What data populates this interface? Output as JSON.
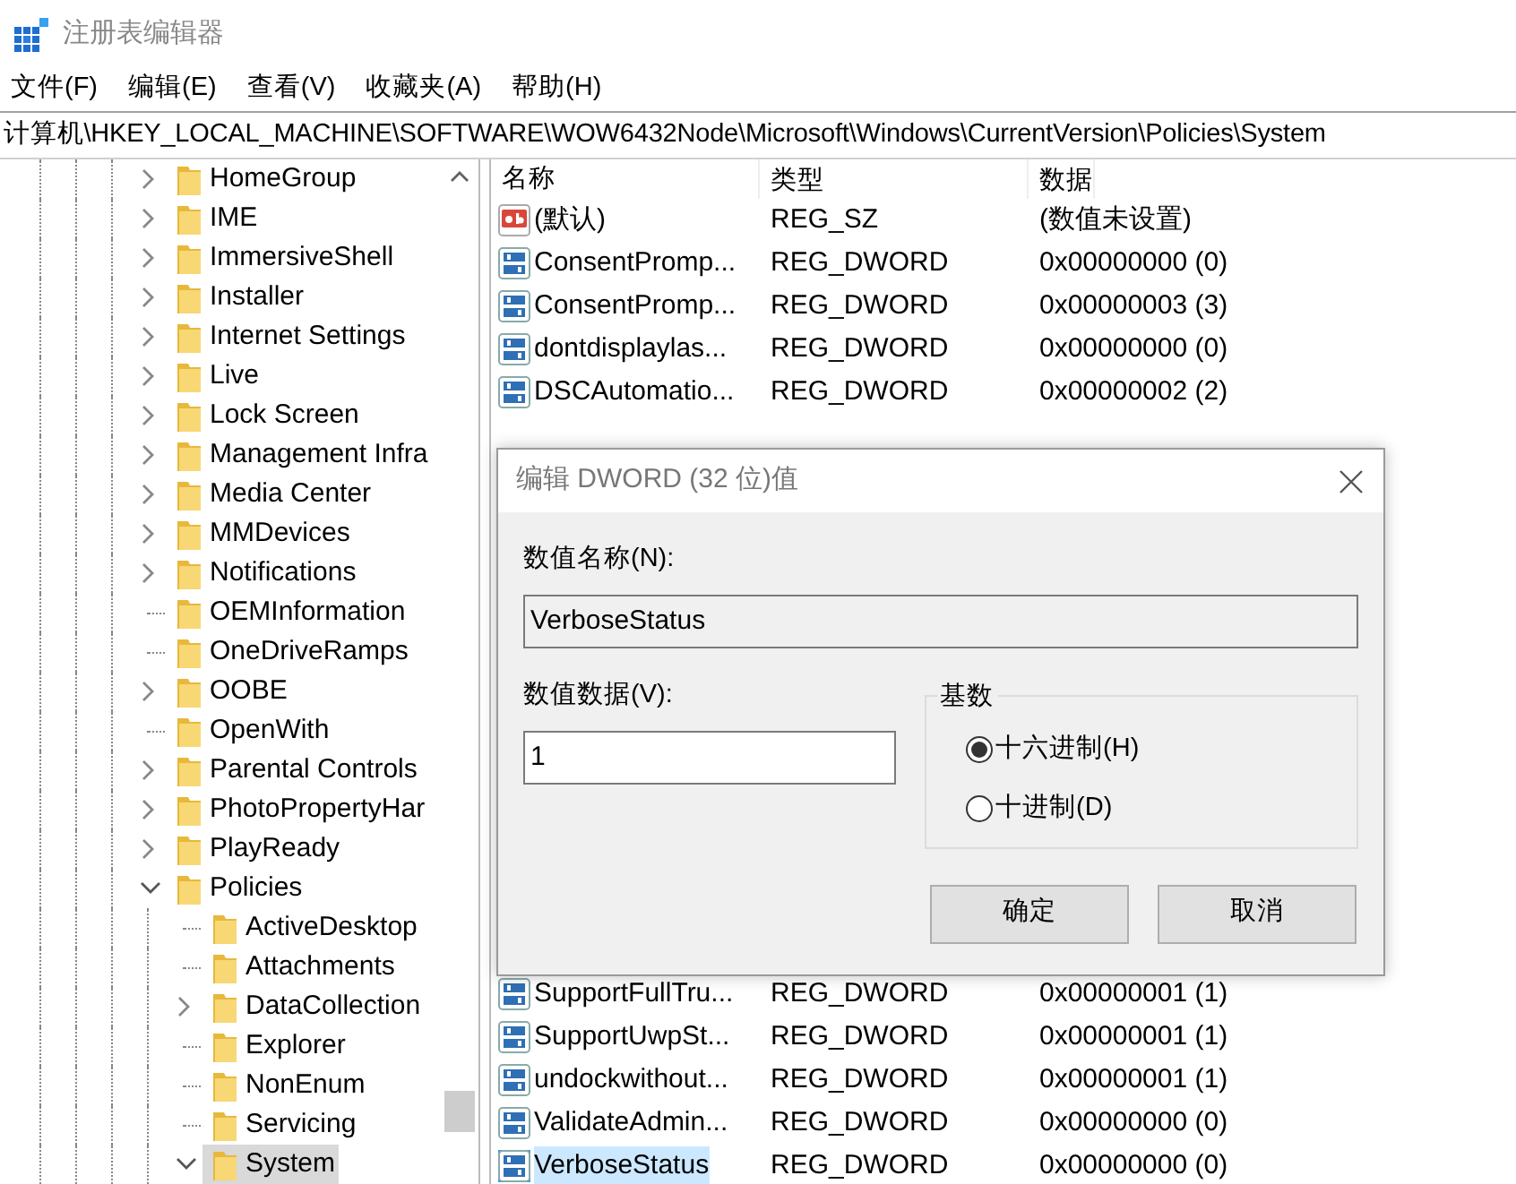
{
  "window": {
    "title": "注册表编辑器"
  },
  "menu": [
    {
      "label": "文件(F)"
    },
    {
      "label": "编辑(E)"
    },
    {
      "label": "查看(V)"
    },
    {
      "label": "收藏夹(A)"
    },
    {
      "label": "帮助(H)"
    }
  ],
  "address": "计算机\\HKEY_LOCAL_MACHINE\\SOFTWARE\\WOW6432Node\\Microsoft\\Windows\\CurrentVersion\\Policies\\System",
  "tree": {
    "items": [
      {
        "label": "HomeGroup",
        "expandable": true,
        "expanded": false,
        "selected": false
      },
      {
        "label": "IME",
        "expandable": true,
        "expanded": false,
        "selected": false
      },
      {
        "label": "ImmersiveShell",
        "expandable": true,
        "expanded": false,
        "selected": false
      },
      {
        "label": "Installer",
        "expandable": true,
        "expanded": false,
        "selected": false
      },
      {
        "label": "Internet Settings",
        "expandable": true,
        "expanded": false,
        "selected": false
      },
      {
        "label": "Live",
        "expandable": true,
        "expanded": false,
        "selected": false
      },
      {
        "label": "Lock Screen",
        "expandable": true,
        "expanded": false,
        "selected": false
      },
      {
        "label": "Management Infra",
        "expandable": true,
        "expanded": false,
        "selected": false
      },
      {
        "label": "Media Center",
        "expandable": true,
        "expanded": false,
        "selected": false
      },
      {
        "label": "MMDevices",
        "expandable": true,
        "expanded": false,
        "selected": false
      },
      {
        "label": "Notifications",
        "expandable": true,
        "expanded": false,
        "selected": false
      },
      {
        "label": "OEMInformation",
        "expandable": false,
        "selected": false
      },
      {
        "label": "OneDriveRamps",
        "expandable": false,
        "selected": false
      },
      {
        "label": "OOBE",
        "expandable": true,
        "expanded": false,
        "selected": false
      },
      {
        "label": "OpenWith",
        "expandable": false,
        "selected": false
      },
      {
        "label": "Parental Controls",
        "expandable": true,
        "expanded": false,
        "selected": false
      },
      {
        "label": "PhotoPropertyHar",
        "expandable": true,
        "expanded": false,
        "selected": false
      },
      {
        "label": "PlayReady",
        "expandable": true,
        "expanded": false,
        "selected": false
      },
      {
        "label": "Policies",
        "expandable": true,
        "expanded": true,
        "selected": false,
        "children": [
          {
            "label": "ActiveDesktop",
            "expandable": false,
            "selected": false
          },
          {
            "label": "Attachments",
            "expandable": false,
            "selected": false
          },
          {
            "label": "DataCollection",
            "expandable": true,
            "expanded": false,
            "selected": false
          },
          {
            "label": "Explorer",
            "expandable": false,
            "selected": false
          },
          {
            "label": "NonEnum",
            "expandable": false,
            "selected": false
          },
          {
            "label": "Servicing",
            "expandable": false,
            "selected": false
          },
          {
            "label": "System",
            "expandable": true,
            "expanded": true,
            "selected": true
          }
        ]
      }
    ]
  },
  "list": {
    "columns": [
      "名称",
      "类型",
      "数据"
    ],
    "rows": [
      {
        "kind": "string",
        "name": "(默认)",
        "type": "REG_SZ",
        "data": "(数值未设置)",
        "selected": false
      },
      {
        "kind": "dword",
        "name": "ConsentPromp...",
        "type": "REG_DWORD",
        "data": "0x00000000 (0)",
        "selected": false
      },
      {
        "kind": "dword",
        "name": "ConsentPromp...",
        "type": "REG_DWORD",
        "data": "0x00000003 (3)",
        "selected": false
      },
      {
        "kind": "dword",
        "name": "dontdisplaylas...",
        "type": "REG_DWORD",
        "data": "0x00000000 (0)",
        "selected": false
      },
      {
        "kind": "dword",
        "name": "DSCAutomatio...",
        "type": "REG_DWORD",
        "data": "0x00000002 (2)",
        "selected": false
      },
      {
        "kind": "dword",
        "name": "SupportFullTru...",
        "type": "REG_DWORD",
        "data": "0x00000001 (1)",
        "selected": false
      },
      {
        "kind": "dword",
        "name": "SupportUwpSt...",
        "type": "REG_DWORD",
        "data": "0x00000001 (1)",
        "selected": false
      },
      {
        "kind": "dword",
        "name": "undockwithout...",
        "type": "REG_DWORD",
        "data": "0x00000001 (1)",
        "selected": false
      },
      {
        "kind": "dword",
        "name": "ValidateAdmin...",
        "type": "REG_DWORD",
        "data": "0x00000000 (0)",
        "selected": false
      },
      {
        "kind": "dword",
        "name": "VerboseStatus",
        "type": "REG_DWORD",
        "data": "0x00000000 (0)",
        "selected": true
      }
    ]
  },
  "dialog": {
    "title": "编辑 DWORD (32 位)值",
    "name_label": "数值名称(N):",
    "name_value": "VerboseStatus",
    "data_label": "数值数据(V):",
    "data_value": "1",
    "base_group": {
      "title": "基数",
      "options": [
        {
          "label": "十六进制(H)",
          "selected": true
        },
        {
          "label": "十进制(D)",
          "selected": false
        }
      ]
    },
    "buttons": [
      "确定",
      "取消"
    ]
  }
}
